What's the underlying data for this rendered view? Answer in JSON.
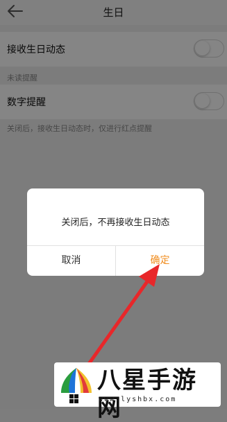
{
  "header": {
    "title": "生日"
  },
  "settings": {
    "receive_birthday_label": "接收生日动态",
    "unread_section": "未读提醒",
    "number_reminder_label": "数字提醒",
    "hint": "关闭后，接收生日动态时，仅进行红点提醒"
  },
  "dialog": {
    "message": "关闭后，不再接收生日动态",
    "cancel_label": "取消",
    "confirm_label": "确定"
  },
  "watermark": {
    "title": "八星手游网",
    "url": "www.lyshbx.com"
  },
  "colors": {
    "confirm": "#f08c1e",
    "arrow": "#e8272a"
  }
}
